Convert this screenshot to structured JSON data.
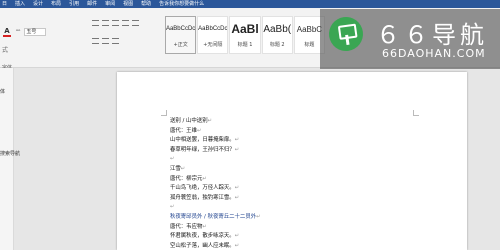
{
  "ribbon_tabs": [
    "日",
    "插入",
    "设计",
    "布局",
    "引用",
    "邮件",
    "审阅",
    "视图",
    "帮助",
    "告诉我你想要做什么"
  ],
  "font": {
    "size_value": "五号",
    "color_glyph": "A",
    "format_painter_glyph": "A",
    "small_glyph": "ᴬᴬ"
  },
  "sidebar": {
    "label_left1": "式",
    "label_left2": "字体 ",
    "nav_label": "搜索导航",
    "group_label": "体"
  },
  "styles": [
    {
      "sample": "AaBbCcDc",
      "name": "+正文",
      "size": "small"
    },
    {
      "sample": "AaBbCcDc",
      "name": "+无间隔",
      "size": "small"
    },
    {
      "sample": "AaBl",
      "name": "标题 1",
      "size": "big"
    },
    {
      "sample": "AaBb(",
      "name": "标题 2",
      "size": "big2"
    },
    {
      "sample": "AaBbC",
      "name": "标题",
      "size": "medium"
    }
  ],
  "watermark": {
    "title": "６６导航",
    "url": "66DAOHAN.COM"
  },
  "document": {
    "lines": [
      {
        "text": "送别 / 山中送别",
        "type": "normal"
      },
      {
        "text": "唐代：王维",
        "type": "normal"
      },
      {
        "text": "山中相送罢，日暮掩柴扉。",
        "type": "normal"
      },
      {
        "text": "春草明年绿，王孙归不归？",
        "type": "normal"
      },
      {
        "text": "",
        "type": "normal"
      },
      {
        "text": "江雪",
        "type": "normal"
      },
      {
        "text": "唐代：柳宗元",
        "type": "normal"
      },
      {
        "text": "千山鸟飞绝，万径人踪灭。",
        "type": "normal"
      },
      {
        "text": "孤舟蓑笠翁，独钓寒江雪。",
        "type": "normal"
      },
      {
        "text": "",
        "type": "normal"
      },
      {
        "text": "秋夜寄邱员外 / 秋夜寄丘二十二员外",
        "type": "link"
      },
      {
        "text": "唐代：韦应物",
        "type": "normal"
      },
      {
        "text": "怀君属秋夜，散步咏凉天。",
        "type": "normal"
      },
      {
        "text": "空山松子落，幽人应未眠。",
        "type": "normal"
      }
    ]
  }
}
